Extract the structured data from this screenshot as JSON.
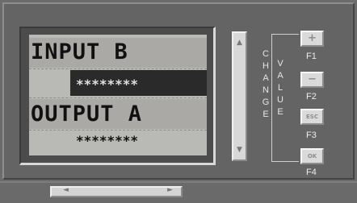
{
  "display": {
    "line1_label": "INPUT B",
    "line1_value": "********",
    "line2_label": "OUTPUT A",
    "line2_value": "********"
  },
  "side_labels": {
    "change": [
      "C",
      "H",
      "A",
      "N",
      "G",
      "E"
    ],
    "value": [
      "V",
      "A",
      "L",
      "U",
      "E"
    ]
  },
  "buttons": [
    {
      "glyph": "+",
      "fkey": "F1"
    },
    {
      "glyph": "−",
      "fkey": "F2"
    },
    {
      "glyph": "ESC",
      "fkey": "F3"
    },
    {
      "glyph": "OK",
      "fkey": "F4"
    }
  ],
  "scroll": {
    "up": "▲",
    "down": "▼",
    "left": "◄",
    "right": "►"
  },
  "colors": {
    "panel": "#646464",
    "lcd": "#b9b9b6",
    "button": "#dadada"
  }
}
